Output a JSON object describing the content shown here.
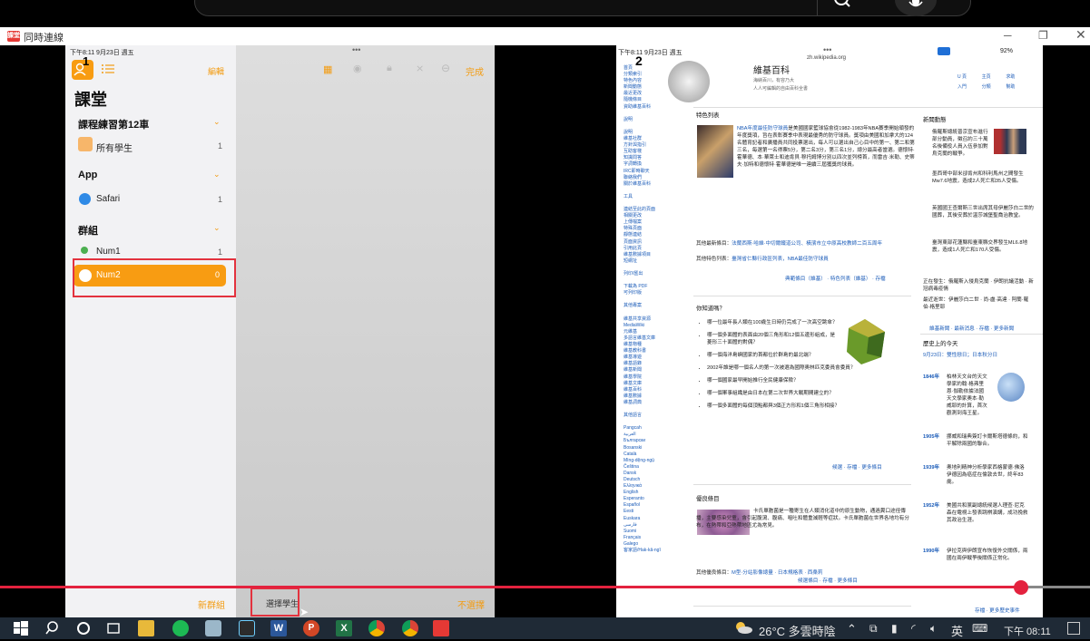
{
  "window": {
    "title": "同時連線",
    "icon_label": "課堂"
  },
  "ipad1": {
    "status_time": "下午8:11  9月23日 週五",
    "status_battery": "91%",
    "edit_label": "編輯",
    "done_label": "完成",
    "title": "課堂",
    "marker": "1",
    "sections": [
      {
        "name": "課程練習第12車",
        "items": [
          {
            "label": "所有學生",
            "count": "1"
          }
        ]
      },
      {
        "name": "App",
        "items": [
          {
            "label": "Safari",
            "count": "1"
          }
        ]
      },
      {
        "name": "群組",
        "items": [
          {
            "label": "Num1",
            "count": "1"
          },
          {
            "label": "Num2",
            "count": "0"
          }
        ]
      }
    ],
    "new_group": "新群組",
    "select_students": "選擇學生",
    "deselect": "不選擇"
  },
  "ipad2": {
    "marker": "2",
    "status_time": "下午8:11  9月23日 週五",
    "url": "zh.wikipedia.org",
    "status_battery": "92%",
    "site_title": "維基百科",
    "site_sub1": "海納百川，有容乃大",
    "site_sub2": "人人可編輯的自由百科全書",
    "header_tabs": [
      "U 頁",
      "主頁",
      "求助",
      "入門",
      "分類",
      "幫助"
    ],
    "sidebar": [
      "首頁",
      "分類索引",
      "特色內容",
      "新聞動態",
      "最近更改",
      "隨機條目",
      "資助維基百科",
      "",
      "說明",
      "",
      "說明",
      "維基社群",
      "方針與指引",
      "互助客棧",
      "知識問答",
      "字詞轉換",
      "IRC即時聊天",
      "聯絡我們",
      "關於維基百科",
      "",
      "工具",
      "",
      "連結至此的頁面",
      "相關更改",
      "上傳檔案",
      "特殊頁面",
      "靜態連結",
      "頁面資訊",
      "引用此頁",
      "維基數據項目",
      "短網址",
      "",
      "列印/匯出",
      "",
      "下載為 PDF",
      "可列印版",
      "",
      "其他專案",
      "",
      "維基共享資源",
      "MediaWiki",
      "元維基",
      "多語言維基文庫",
      "維基物種",
      "維基教科書",
      "維基導遊",
      "維基語錄",
      "維基新聞",
      "維基學院",
      "維基文庫",
      "維基百科",
      "維基數據",
      "維基詞典",
      "",
      "其他語言",
      "",
      "Pangcah",
      "العربية",
      "Български",
      "Bosanski",
      "Català",
      "Mìng-dĕ̤ng-ngṳ̄",
      "Čeština",
      "Dansk",
      "Deutsch",
      "Ελληνικά",
      "English",
      "Esperanto",
      "Español",
      "Eesti",
      "Euskara",
      "فارسی",
      "Suomi",
      "Français",
      "Galego",
      "客家語/Hak-kâ-ngî"
    ],
    "featured_title": "特色列表",
    "featured_lead": "NBA年度最佳防守球員",
    "featured_body": "是美國國家籃球協會從1982-1983年NBA賽季開始頒發的年度獎項，旨在表彰賽季中表現最優秀的防守球員。獎項由美國和加拿大的124名體育記者和廣播員共同投票選出，每人可以選出自己心目中的第一、第二和第三名，每選第一名得票5分，第二名3分，第三名1分，總分最高者當選。德懷特·霍華德、本·華萊士和迪肯貝·穆托姆博分別以四次並列榜首，而雷吉·米勒、史蒂夫·加特和德懷特·霍華德是唯一連續三屆獲獎的球員。",
    "featured_other": "其他最新條目：",
    "featured_other_links": "法蘭西斯·哈維·中切爾鐵道公司、橫濱市立中原高校教師二百五周年",
    "featured_other2": "其他特色列表：",
    "featured_other2_links": "臺灣省仁縣行政區列表，NBA最佳防守球員",
    "featured_footer": "典範條目（維基） · 特色列表（維基） · 存檔",
    "dyk_title": "你知道嗎？",
    "dyk_items": [
      "哪一位最年長人類在100歲生日時仍完成了一次高空跳傘？",
      "哪一個多面體的表面由20個三角形和12個五邊形組成，是菱形三十面體的對偶？",
      "哪一個海洋島嶼國家的首都位於群島的最北端？",
      "2002年誰是哪一個名人的第一次被選為國際奧林匹克委員會委員？",
      "哪一個國家最早開始推行全民健康保險？",
      "哪一個軍事組織是由日本在第二次世界大戰期間建立的？",
      "哪一個多面體的每個頂點都與3個正方形和1個三角形相接？"
    ],
    "dyk_footer": "候選 · 存檔 · 更多條目",
    "good_title": "優良條目",
    "good_body": "卡氏單胞菌是一種寄生在人類消化道中的原生動物，通過糞口途徑傳播，主要感染兒童，會引起腹瀉、腹痛、嘔吐和體重減輕等症狀。卡氏單胞菌在世界各地均有分布，在熱帶和亞熱帶地區尤為常見。",
    "good_other": "其他優良條目：",
    "good_other_links": "M型·分站影像總量 · 日本規格表 · 西桑莉",
    "good_footer": "候選條目 · 存檔 · 更多條目",
    "news_title": "新聞動態",
    "news_items": [
      "俄羅斯總統普京宣布進行部分動員，徵召約三十萬名後備役人員入伍參加對烏克蘭的戰爭。",
      "墨西哥中部米卻肯州和科利馬州之間發生Mw7.6地震，造成2人死亡和35人受傷。",
      "英國國王查爾斯三世出席其母伊麗莎白二世的國葬，其後安葬於溫莎城堡聖喬治教堂。",
      "臺灣東部花蓮縣和臺東縣交界發生ML6.8地震，造成1人死亡和170人受傷。"
    ],
    "news_ongoing": "正在發生：俄羅斯入侵烏克蘭 · 伊朗抗議活動 · 新冠病毒疫情",
    "news_recent": "最近逝世：伊麗莎白二世 · 尚-盧·高達 · 阿蘭·羅伯-格里耶",
    "news_footer": "維基新聞 · 最新消息 · 存檔 · 更多新聞",
    "today_title": "歷史上的今天",
    "today_date": "9月23日：雙性戀日；日本秋分日",
    "today_items": [
      {
        "year": "1846年",
        "text": "柏林天文台的天文學家約翰·格弗里恩·伽勒依據法國天文學家奧本·勒威耶的計算，首次觀測到海王星。"
      },
      {
        "year": "1905年",
        "text": "挪威和瑞典簽訂卡爾斯塔德條約，和平解除兩國的聯合。"
      },
      {
        "year": "1939年",
        "text": "奧地利精神分析學家西格蒙德·佛洛伊德因為癌症在倫敦去世，終年83歲。"
      },
      {
        "year": "1952年",
        "text": "美國共和黨副總統候選人理查·尼克森在電視上發表跳棋演講，成功挽救其政治生涯。"
      },
      {
        "year": "1990年",
        "text": "伊拉克與伊朗宣布恢復外交關係，兩國在兩伊戰爭後關係正常化。"
      }
    ],
    "today_footer": "存檔 · 更多歷史事件"
  },
  "taskbar": {
    "weather": "26°C  多雲時陰",
    "ime": "英",
    "clock": "下午 08:11"
  },
  "progress_fraction": 0.937,
  "colors": {
    "accent": "#f39c12",
    "highlight": "#e3323e",
    "link": "#1a5bb8"
  }
}
